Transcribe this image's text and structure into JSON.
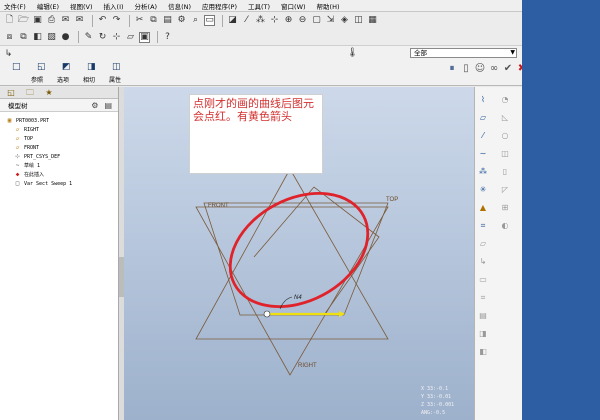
{
  "menu": [
    "文件(F)",
    "编辑(E)",
    "视图(V)",
    "插入(I)",
    "分析(A)",
    "信息(N)",
    "应用程序(P)",
    "工具(T)",
    "窗口(W)",
    "帮助(H)"
  ],
  "toolbar1_icons": [
    "new-icon",
    "open-icon",
    "save-icon",
    "print-icon",
    "email-icon",
    "email2-icon",
    "undo-icon",
    "redo-icon",
    "cut-icon",
    "copy-icon",
    "paste-icon",
    "regenerate-icon",
    "find-icon",
    "select-icon",
    "datum-display-icon",
    "axis-icon",
    "point-icon",
    "csys-icon",
    "zoom-in-icon",
    "zoom-out-icon",
    "refit-icon",
    "orient-icon",
    "view-icon",
    "layer-icon",
    "saved-view-icon"
  ],
  "toolbar2_icons": [
    "window-icon",
    "window2-icon",
    "shade-icon",
    "wireframe-icon",
    "sketch-icon",
    "spin-icon",
    "annotation-icon",
    "datum-plane-icon",
    "help-icon"
  ],
  "dashboard": {
    "tabs": [
      "参照",
      "选项",
      "相切",
      "属性"
    ],
    "select_value": "全部"
  },
  "left_pane": {
    "header": "模型树",
    "tree": [
      {
        "label": "PRT0003.PRT",
        "icon": "part-icon",
        "indent": 0
      },
      {
        "label": "RIGHT",
        "icon": "datum-plane-icon",
        "indent": 1
      },
      {
        "label": "TOP",
        "icon": "datum-plane-icon",
        "indent": 1
      },
      {
        "label": "FRONT",
        "icon": "datum-plane-icon",
        "indent": 1
      },
      {
        "label": "PRT_CSYS_DEF",
        "icon": "csys-icon",
        "indent": 1
      },
      {
        "label": "草绘 1",
        "icon": "sketch-icon",
        "indent": 1
      },
      {
        "label": "在此插入",
        "icon": "insert-here-icon",
        "indent": 1
      },
      {
        "label": "Var Sect Sweep 1",
        "icon": "sweep-icon",
        "indent": 1
      }
    ]
  },
  "canvas": {
    "note": "点刚才的画的曲线后图元会点红。有黄色箭头",
    "labels": {
      "front": "FRONT",
      "top": "TOP",
      "right": "RIGHT",
      "origin": "N4"
    },
    "readout": [
      "X 33:-0.1",
      "Y 33:-0.01",
      "Z 33:-0.001",
      "ANG:-0.5"
    ]
  }
}
